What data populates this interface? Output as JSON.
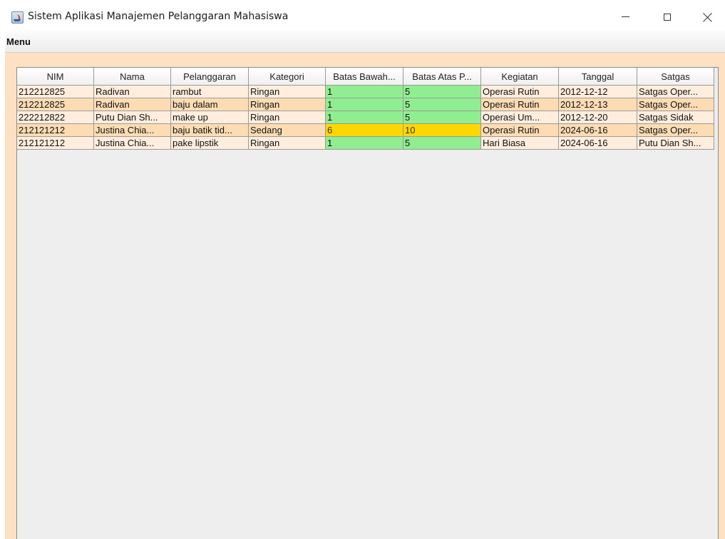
{
  "window": {
    "title": "Sistem Aplikasi Manajemen Pelanggaran Mahasiswa"
  },
  "menubar": {
    "menu_label": "Menu"
  },
  "table": {
    "columns": [
      "NIM",
      "Nama",
      "Pelanggaran",
      "Kategori",
      "Batas Bawah...",
      "Batas Atas P...",
      "Kegiatan",
      "Tanggal",
      "Satgas"
    ],
    "rows": [
      [
        "212212825",
        "Radivan",
        "rambut",
        "Ringan",
        "1",
        "5",
        "Operasi Rutin",
        "2012-12-12",
        "Satgas Oper..."
      ],
      [
        "212212825",
        "Radivan",
        "baju dalam",
        "Ringan",
        "1",
        "5",
        "Operasi Rutin",
        "2012-12-13",
        "Satgas Oper..."
      ],
      [
        "222212822",
        "Putu Dian Sh...",
        "make up",
        "Ringan",
        "1",
        "5",
        "Operasi Um...",
        "2012-12-20",
        "Satgas Sidak"
      ],
      [
        "212121212",
        "Justina Chia...",
        "baju batik tid...",
        "Sedang",
        "6",
        "10",
        "Operasi Rutin",
        "2024-06-16",
        "Satgas Oper..."
      ],
      [
        "212121212",
        "Justina Chia...",
        "pake lipstik",
        "Ringan",
        "1",
        "5",
        "Hari Biasa",
        "2024-06-16",
        "Putu Dian Sh..."
      ]
    ],
    "row_colors": [
      "#ffeedd",
      "#fddcb4",
      "#ffeedd",
      "#fddcb4",
      "#ffeedd"
    ],
    "batas_colors": [
      "#90ee90",
      "#90ee90",
      "#90ee90",
      "#ffd700",
      "#90ee90"
    ]
  },
  "colors": {
    "content_background": "#fde1c2",
    "table_empty_area": "#eeeeee",
    "ringan_highlight": "#90ee90",
    "sedang_highlight": "#ffd700"
  }
}
